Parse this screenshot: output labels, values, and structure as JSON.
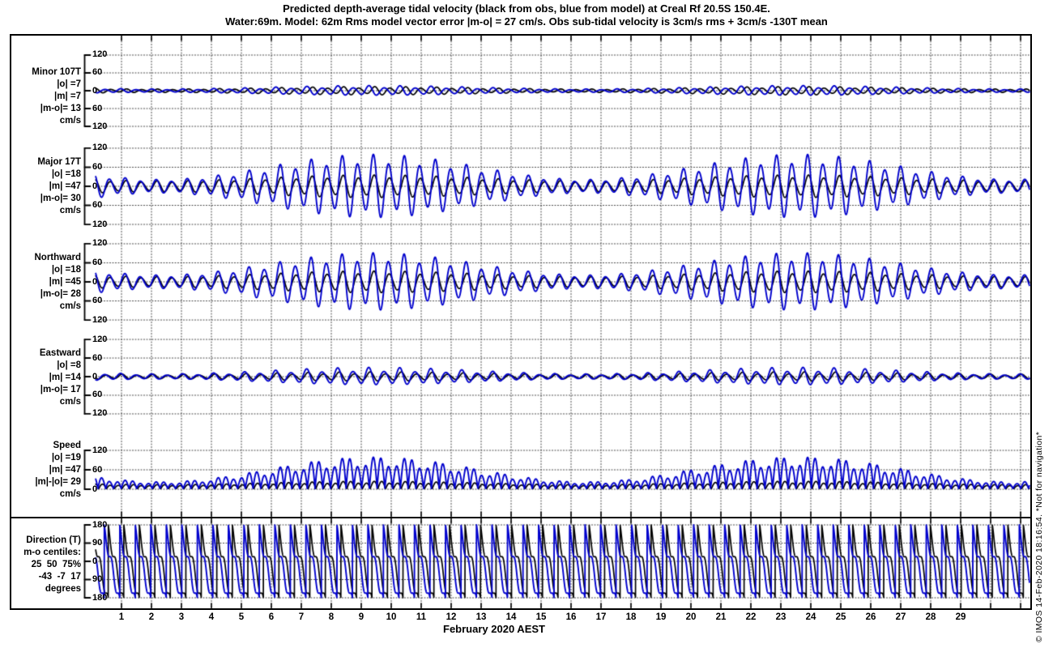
{
  "title": {
    "line1": "Predicted depth-average tidal velocity (black from obs, blue from model) at Creal Rf 20.5S 150.4E.",
    "line2": "Water:69m. Model: 62m  Rms model vector error |m-o| = 27 cm/s. Obs sub-tidal velocity is 3cm/s rms + 3cm/s -130T mean"
  },
  "figure": {
    "xlabel": "February 2020 AEST",
    "copyright": "© IMOS 14-Feb-2020 18:16:54. *Not for navigation*",
    "colors": {
      "obs": "#000000",
      "model": "#0000cc",
      "grid": "#3a3a3a",
      "axis": "#000000"
    }
  },
  "x_axis": {
    "day_labels": [
      "1",
      "2",
      "3",
      "4",
      "5",
      "6",
      "7",
      "8",
      "9",
      "10",
      "11",
      "12",
      "13",
      "14",
      "15",
      "16",
      "17",
      "18",
      "19",
      "20",
      "21",
      "22",
      "23",
      "24",
      "25",
      "26",
      "27",
      "28",
      "29"
    ]
  },
  "chart_data": [
    {
      "type": "line",
      "name": "minor-velocity",
      "label_lines": [
        "Minor 107T",
        "|o| =7",
        "|m| =7",
        "|m-o|= 13",
        "cm/s"
      ],
      "units": "cm/s",
      "ylim": [
        -120,
        120
      ],
      "y_tick_values": [
        120,
        60,
        0,
        -60,
        -120
      ],
      "y_tick_labels": [
        "120",
        "60",
        "0",
        "60",
        "120"
      ],
      "series": [
        {
          "name": "obs",
          "color": "obs",
          "kind": "wave",
          "base": 8,
          "a1": 0.42,
          "phase": 0.0,
          "ineq": 0.3
        },
        {
          "name": "model",
          "color": "model",
          "kind": "wave",
          "base": 9,
          "a1": 0.5,
          "phase": 2.3,
          "ineq": 0.3
        }
      ]
    },
    {
      "type": "line",
      "name": "major-velocity",
      "label_lines": [
        "Major 17T",
        "|o| =18",
        "|m| =47",
        "|m-o|= 30",
        "cm/s"
      ],
      "units": "cm/s",
      "ylim": [
        -120,
        120
      ],
      "y_tick_values": [
        120,
        60,
        0,
        -60,
        -120
      ],
      "y_tick_labels": [
        "120",
        "60",
        "0",
        "60",
        "120"
      ],
      "series": [
        {
          "name": "obs",
          "color": "obs",
          "kind": "wave",
          "base": 23,
          "a1": 0.35,
          "phase": 0.2,
          "ineq": 0.2
        },
        {
          "name": "model",
          "color": "model",
          "kind": "wave",
          "base": 52,
          "a1": 0.65,
          "phase": 0.55,
          "ineq": 0.22
        }
      ]
    },
    {
      "type": "line",
      "name": "northward-velocity",
      "label_lines": [
        "Northward",
        "|o| =18",
        "|m| =45",
        "|m-o|= 28",
        "cm/s"
      ],
      "units": "cm/s",
      "ylim": [
        -120,
        120
      ],
      "y_tick_values": [
        120,
        60,
        0,
        -60,
        -120
      ],
      "y_tick_labels": [
        "120",
        "60",
        "0",
        "60",
        "120"
      ],
      "series": [
        {
          "name": "obs",
          "color": "obs",
          "kind": "wave",
          "base": 22,
          "a1": 0.35,
          "phase": 0.3,
          "ineq": 0.2
        },
        {
          "name": "model",
          "color": "model",
          "kind": "wave",
          "base": 48,
          "a1": 0.62,
          "phase": 0.65,
          "ineq": 0.22
        }
      ]
    },
    {
      "type": "line",
      "name": "eastward-velocity",
      "label_lines": [
        "Eastward",
        "|o| =8",
        "|m| =14",
        "|m-o|= 17",
        "cm/s"
      ],
      "units": "cm/s",
      "ylim": [
        -120,
        120
      ],
      "y_tick_values": [
        120,
        60,
        0,
        -60,
        -120
      ],
      "y_tick_labels": [
        "120",
        "60",
        "0",
        "60",
        "120"
      ],
      "series": [
        {
          "name": "obs",
          "color": "obs",
          "kind": "wave",
          "base": 9,
          "a1": 0.35,
          "phase": 1.8,
          "ineq": 0.3
        },
        {
          "name": "model",
          "color": "model",
          "kind": "wave",
          "base": 15,
          "a1": 0.55,
          "phase": 2.4,
          "ineq": 0.3
        }
      ]
    },
    {
      "type": "line",
      "name": "speed",
      "label_lines": [
        "Speed",
        "|o| =19",
        "|m| =47",
        "|m|-|o|= 29",
        "cm/s"
      ],
      "units": "cm/s",
      "ylim": [
        0,
        120
      ],
      "y_tick_values": [
        120,
        60,
        0
      ],
      "y_tick_labels": [
        "120",
        "60",
        "0"
      ],
      "series": [
        {
          "name": "obs",
          "color": "obs",
          "kind": "abs",
          "base": 15,
          "a1": 0.3,
          "phase": 0.2,
          "ineq": 0.2,
          "offset": 2
        },
        {
          "name": "model",
          "color": "model",
          "kind": "abs",
          "base": 50,
          "a1": 0.65,
          "phase": 0.55,
          "ineq": 0.22,
          "offset": 2
        }
      ]
    },
    {
      "type": "line",
      "name": "direction",
      "label_lines": [
        "Direction (T)",
        "m-o centiles:",
        "25  50  75%",
        "-43  -7  17",
        "degrees"
      ],
      "units": "degrees",
      "ylim": [
        -180,
        180
      ],
      "y_tick_values": [
        180,
        90,
        0,
        -90,
        -180
      ],
      "y_tick_labels": [
        "180",
        "90",
        "0",
        "90",
        "180"
      ],
      "series": [
        {
          "name": "obs",
          "color": "obs",
          "kind": "direction",
          "phase": 0.0,
          "wobble": 30
        },
        {
          "name": "model",
          "color": "model",
          "kind": "direction",
          "phase": 0.26,
          "wobble": 30
        }
      ]
    }
  ],
  "synthesis_shared": {
    "carrier_period_days": 0.5175,
    "ineq_period_days": 1.0351,
    "envelope_peak_day": 9.4,
    "envelope_period_days": 14.2,
    "time_start_day": 0.14,
    "time_end_day": 31.3
  }
}
